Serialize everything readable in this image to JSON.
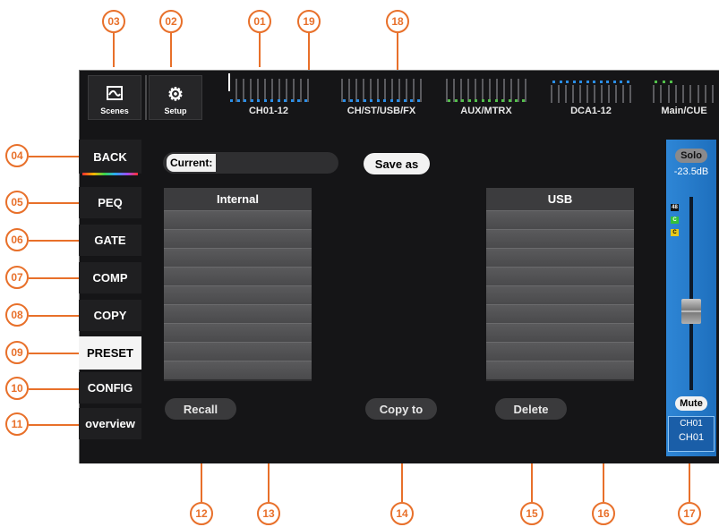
{
  "callouts": [
    "03",
    "02",
    "01",
    "19",
    "18",
    "04",
    "05",
    "06",
    "07",
    "08",
    "09",
    "10",
    "11",
    "12",
    "13",
    "14",
    "15",
    "16",
    "17"
  ],
  "topbar": {
    "scenes_label": "Scenes",
    "setup_label": "Setup",
    "meters": [
      {
        "label": "CH01-12"
      },
      {
        "label": "CH/ST/USB/FX"
      },
      {
        "label": "AUX/MTRX"
      },
      {
        "label": "DCA1-12"
      },
      {
        "label": "Main/CUE"
      }
    ]
  },
  "sidebar": {
    "items": [
      {
        "label": "BACK"
      },
      {
        "label": "PEQ"
      },
      {
        "label": "GATE"
      },
      {
        "label": "COMP"
      },
      {
        "label": "COPY"
      },
      {
        "label": "PRESET"
      },
      {
        "label": "CONFIG"
      },
      {
        "label": "overview"
      }
    ]
  },
  "main": {
    "current_label": "Current:",
    "save_as_label": "Save as",
    "internal_header": "Internal",
    "usb_header": "USB",
    "recall_label": "Recall",
    "copy_to_label": "Copy to",
    "delete_label": "Delete"
  },
  "channel_strip": {
    "solo_label": "Solo",
    "level": "-23.5dB",
    "meter_marks": [
      "48",
      "C",
      "C"
    ],
    "mute_label": "Mute",
    "channel_name": "CH01",
    "channel_id": "CH01"
  },
  "colors": {
    "accent": "#e8702a",
    "strip_blue": "#2e86d6"
  }
}
